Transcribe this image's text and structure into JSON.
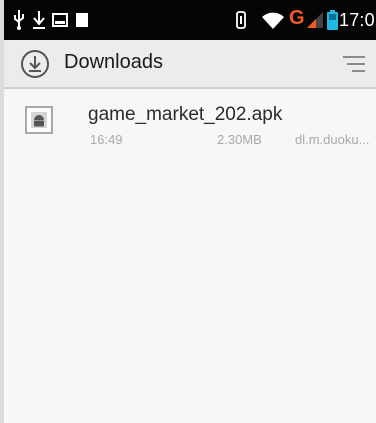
{
  "status_bar": {
    "time": "17:0",
    "network_label": "G",
    "icons": [
      "usb-icon",
      "download-icon",
      "image-icon",
      "notification-icon",
      "vibrate-icon",
      "wifi-icon",
      "signal-icon",
      "battery-icon"
    ]
  },
  "app_bar": {
    "title": "Downloads",
    "app_icon": "download-circle-icon",
    "sort_icon": "sort-icon"
  },
  "downloads": [
    {
      "name": "game_market_202.apk",
      "time": "16:49",
      "size": "2.30MB",
      "source": "dl.m.duoku...",
      "icon": "android-icon"
    }
  ],
  "colors": {
    "status_bar": "#050505",
    "app_bar": "#ececec",
    "background": "#f7f7f7",
    "network_accent": "#f15a24",
    "battery_accent": "#22b8e6"
  }
}
